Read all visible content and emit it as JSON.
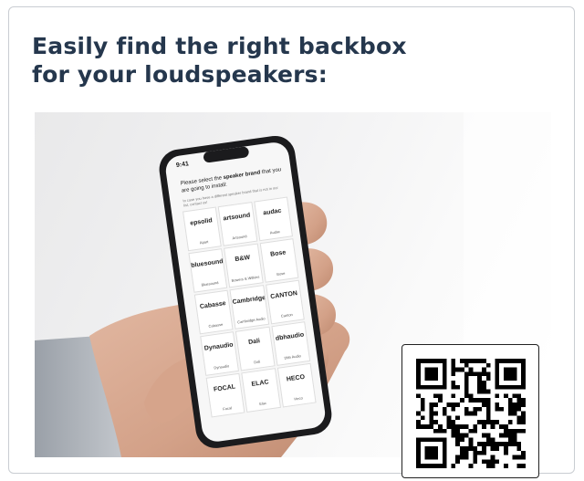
{
  "headline": {
    "line1": "Easily find the right backbox",
    "line2": "for your loudspeakers:"
  },
  "phone": {
    "status_time": "9:41",
    "prompt_prefix": "Please select the ",
    "prompt_bold": "speaker brand",
    "prompt_suffix": " that you are going to install:",
    "helper": "In case you have a different speaker brand that is not in our list, contact us!",
    "brands": [
      {
        "logo": "epsolid",
        "label": "Apart"
      },
      {
        "logo": "artsound",
        "label": "Artsound"
      },
      {
        "logo": "audac",
        "label": "Audac"
      },
      {
        "logo": "bluesound",
        "label": "Bluesound"
      },
      {
        "logo": "B&W",
        "label": "Bowers & Wilkins"
      },
      {
        "logo": "Bose",
        "label": "Bose"
      },
      {
        "logo": "Cabasse",
        "label": "Cabasse"
      },
      {
        "logo": "Cambridge",
        "label": "Cambridge Audio"
      },
      {
        "logo": "CANTON",
        "label": "Canton"
      },
      {
        "logo": "Dynaudio",
        "label": "Dynaudio"
      },
      {
        "logo": "Dali",
        "label": "Dali"
      },
      {
        "logo": "dbhaudio",
        "label": "Dbh Audio"
      },
      {
        "logo": "FOCAL",
        "label": "Focal"
      },
      {
        "logo": "ELAC",
        "label": "Elac"
      },
      {
        "logo": "HECO",
        "label": "Heco"
      }
    ]
  },
  "qr": {
    "icon": "qr-code"
  }
}
